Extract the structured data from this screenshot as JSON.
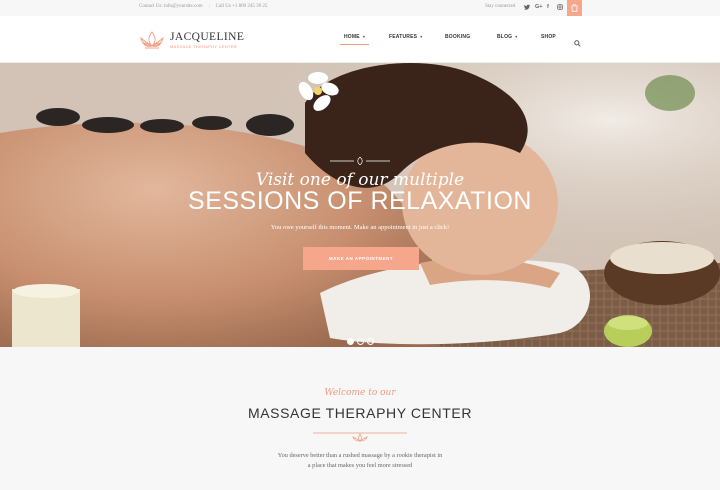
{
  "topbar": {
    "contact_email": "Contact Us: info@yoursite.com",
    "contact_phone": "Call Us +1 800 245 39 25",
    "stay_connected": "Stay connected",
    "social": [
      {
        "name": "twitter-icon",
        "glyph": "t"
      },
      {
        "name": "google-plus-icon",
        "glyph": "G+"
      },
      {
        "name": "facebook-icon",
        "glyph": "f"
      },
      {
        "name": "instagram-icon",
        "glyph": "◻"
      }
    ]
  },
  "logo": {
    "title": "JACQUELINE",
    "subtitle": "MASSAGE THERAPHY CENTER"
  },
  "nav": {
    "items": [
      {
        "label": "HOME",
        "active": true,
        "dropdown": true
      },
      {
        "label": "FEATURES",
        "active": false,
        "dropdown": true
      },
      {
        "label": "BOOKING",
        "active": false,
        "dropdown": false
      },
      {
        "label": "BLOG",
        "active": false,
        "dropdown": true
      },
      {
        "label": "SHOP",
        "active": false,
        "dropdown": false
      }
    ]
  },
  "hero": {
    "script": "Visit one of our multiple",
    "title": "SESSIONS OF RELAXATION",
    "subtitle": "You owe yourself this moment. Make an appointment in just a click!",
    "button_label": "MAKE AN APPOINTMENT",
    "slides_total": 3,
    "active_slide": 1
  },
  "welcome": {
    "script": "Welcome to our",
    "title": "MASSAGE THERAPHY CENTER",
    "text_line1": "You deserve better than a rushed massage by a rookie therapist in",
    "text_line2": "a place that makes you feel more stressed"
  },
  "colors": {
    "accent": "#f6a68a",
    "accent_text": "#f19a7e",
    "topbar_bg": "#f7f7f7"
  }
}
